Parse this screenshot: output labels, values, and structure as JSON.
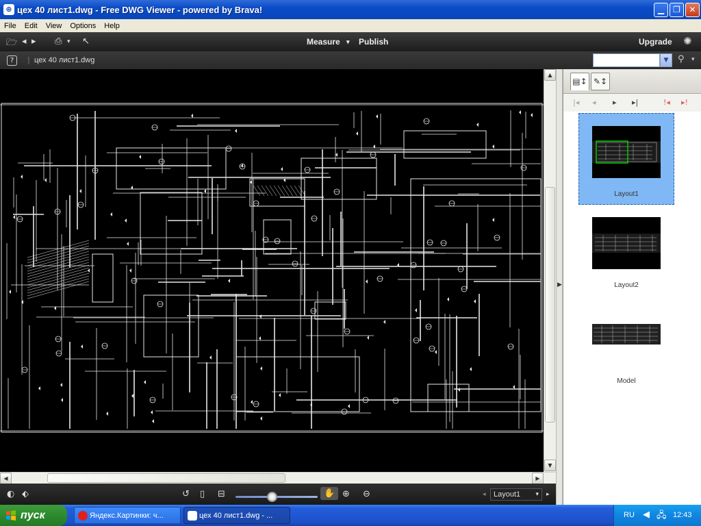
{
  "window": {
    "title": "цех 40 лист1.dwg - Free DWG Viewer - powered by Brava!",
    "app_icon": "brava-icon"
  },
  "menu": [
    "File",
    "Edit",
    "View",
    "Options",
    "Help"
  ],
  "toolbar": {
    "measure": "Measure",
    "publish": "Publish",
    "upgrade": "Upgrade"
  },
  "filebar": {
    "help_label": "?",
    "file_name": "цех 40 лист1.dwg"
  },
  "layout_panel": {
    "layouts": [
      {
        "label": "Layout1",
        "selected": true
      },
      {
        "label": "Layout2",
        "selected": false
      },
      {
        "label": "Model",
        "selected": false
      }
    ]
  },
  "bottom": {
    "layout_select": "Layout1",
    "zoom_level": 0.45
  },
  "taskbar": {
    "start_label": "пуск",
    "items": [
      {
        "label": "Яндекс.Картинки: ч...",
        "active": false,
        "icon": "opera-icon"
      },
      {
        "label": "цех 40 лист1.dwg - ...",
        "active": true,
        "icon": "brava-icon"
      }
    ],
    "lang": "RU",
    "clock": "12:43"
  },
  "colors": {
    "accent": "#0a4cc8",
    "canvas": "#000000",
    "selected": "#7fb8f4"
  }
}
